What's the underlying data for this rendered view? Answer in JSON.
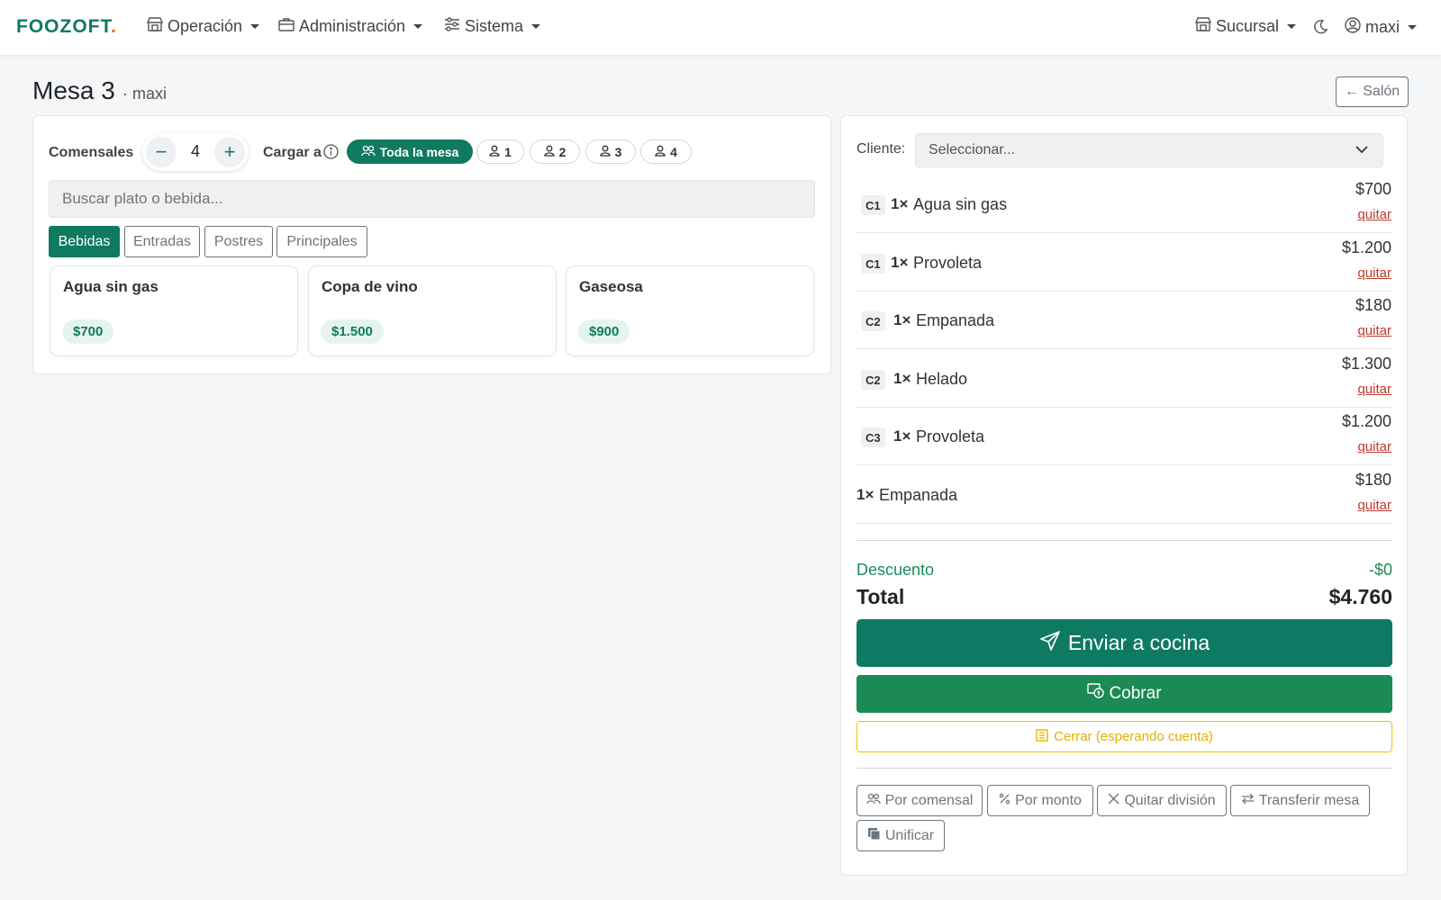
{
  "navbar": {
    "brand": "FOOZOFT",
    "brand_dot": ".",
    "menu": [
      {
        "label": "Operación",
        "icon": "store-icon"
      },
      {
        "label": "Administración",
        "icon": "briefcase-icon"
      },
      {
        "label": "Sistema",
        "icon": "sliders-icon"
      }
    ],
    "branch_label": "Sucursal",
    "user_label": "maxi"
  },
  "page": {
    "title": "Mesa 3",
    "subtitle": "· maxi",
    "back_button": "← Salón"
  },
  "diners": {
    "label": "Comensales",
    "count": "4",
    "minus": "−",
    "plus": "+"
  },
  "load_to": {
    "label": "Cargar a",
    "options": [
      "Toda la mesa",
      "1",
      "2",
      "3",
      "4"
    ],
    "selected": "Toda la mesa"
  },
  "search": {
    "placeholder": "Buscar plato o bebida..."
  },
  "categories": [
    "Bebidas",
    "Entradas",
    "Postres",
    "Principales"
  ],
  "active_category": "Bebidas",
  "products": [
    {
      "name": "Agua sin gas",
      "price": "$700"
    },
    {
      "name": "Copa de vino",
      "price": "$1.500"
    },
    {
      "name": "Gaseosa",
      "price": "$900"
    }
  ],
  "client": {
    "label": "Cliente:",
    "placeholder": "Seleccionar..."
  },
  "order_items": [
    {
      "diner": "C1",
      "qty": "1×",
      "name": "Agua sin gas",
      "price": "$700",
      "remove": "quitar"
    },
    {
      "diner": "C1",
      "qty": "1×",
      "name": "Provoleta",
      "price": "$1.200",
      "remove": "quitar"
    },
    {
      "diner": "C2",
      "qty": "1×",
      "name": "Empanada",
      "price": "$180",
      "remove": "quitar"
    },
    {
      "diner": "C2",
      "qty": "1×",
      "name": "Helado",
      "price": "$1.300",
      "remove": "quitar"
    },
    {
      "diner": "C3",
      "qty": "1×",
      "name": "Provoleta",
      "price": "$1.200",
      "remove": "quitar"
    },
    {
      "diner": "",
      "qty": "1×",
      "name": "Empanada",
      "price": "$180",
      "remove": "quitar"
    }
  ],
  "totals": {
    "discount_label": "Descuento",
    "discount_value": "-$0",
    "total_label": "Total",
    "total_value": "$4.760"
  },
  "actions": {
    "send_kitchen": "Enviar a cocina",
    "charge": "Cobrar",
    "close": "Cerrar (esperando cuenta)",
    "by_diner": "Por comensal",
    "by_amount": "Por monto",
    "remove_split": "Quitar división",
    "transfer_table": "Transferir mesa",
    "merge": "Unificar"
  },
  "colors": {
    "primary": "#0f7a5f",
    "success": "#1b8a55",
    "warning": "#f2c200",
    "danger": "#c0392b",
    "brand_dot": "#f06a1d"
  }
}
